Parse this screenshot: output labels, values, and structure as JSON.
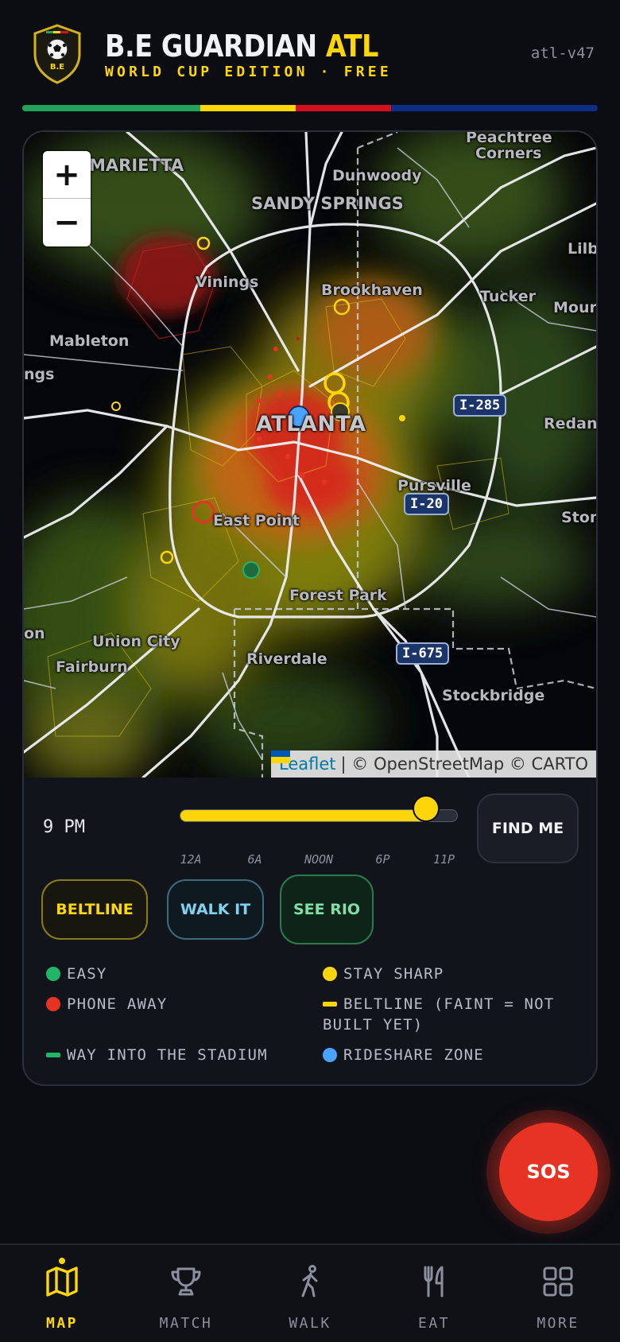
{
  "header": {
    "logo_text": "B.E",
    "title_main": "B.E GUARDIAN",
    "title_accent": "ATL",
    "subtitle": "WORLD CUP EDITION · FREE",
    "version": "atl-v47",
    "stripe_colors": [
      "#21a35a",
      "#ffd60a",
      "#d0101c",
      "#0b2e86"
    ]
  },
  "map": {
    "zoom_in": "+",
    "zoom_out": "−",
    "attribution_link": "Leaflet",
    "attribution_rest": "| © OpenStreetMap © CARTO",
    "labels": {
      "marietta": "MARIETTA",
      "dunwoody": "Dunwoody",
      "peachtree": "Peachtree",
      "corners": "Corners",
      "sandy_springs": "SANDY SPRINGS",
      "lilb": "Lilb",
      "vinings": "Vinings",
      "brookhaven": "Brookhaven",
      "tucker": "Tucker",
      "mour": "Mour",
      "mableton": "Mableton",
      "ngs": "ngs",
      "atlanta": "ATLANTA",
      "redan": "Redan",
      "pursville": "Pursville",
      "ston": "Ston",
      "east_point": "East Point",
      "forest_park": "Forest Park",
      "on": "on",
      "union_city": "Union City",
      "fairburn": "Fairburn",
      "riverdale": "Riverdale",
      "stockbridge": "Stockbridge"
    },
    "shields": {
      "i285": "I-285",
      "i20": "I-20",
      "i675": "I-675"
    }
  },
  "controls": {
    "time_label": "9 PM",
    "slider_value_fraction": 0.885,
    "ticks": [
      "12A",
      "6A",
      "NOON",
      "6P",
      "11P"
    ],
    "find_me": "FIND ME",
    "buttons": {
      "beltline": "BELTLINE",
      "walk_it": "WALK IT",
      "see_rio": "SEE RIO"
    }
  },
  "legend": {
    "easy": {
      "label": "EASY",
      "color": "#21b567"
    },
    "stay_sharp": {
      "label": "STAY SHARP",
      "color": "#ffd60a"
    },
    "phone_away": {
      "label": "PHONE AWAY",
      "color": "#e63324"
    },
    "beltline": {
      "label": "BELTLINE (FAINT = NOT BUILT YET)",
      "color": "#ffd60a"
    },
    "stadium": {
      "label": "WAY INTO THE STADIUM",
      "color": "#21b567"
    },
    "rideshare": {
      "label": "RIDESHARE ZONE",
      "color": "#4aa3ff"
    }
  },
  "sos": "SOS",
  "nav": {
    "items": [
      {
        "label": "MAP",
        "icon": "map-icon",
        "active": true
      },
      {
        "label": "MATCH",
        "icon": "trophy-icon",
        "active": false
      },
      {
        "label": "WALK",
        "icon": "walking-person-icon",
        "active": false
      },
      {
        "label": "EAT",
        "icon": "fork-knife-icon",
        "active": false
      },
      {
        "label": "MORE",
        "icon": "grid-icon",
        "active": false
      }
    ]
  }
}
